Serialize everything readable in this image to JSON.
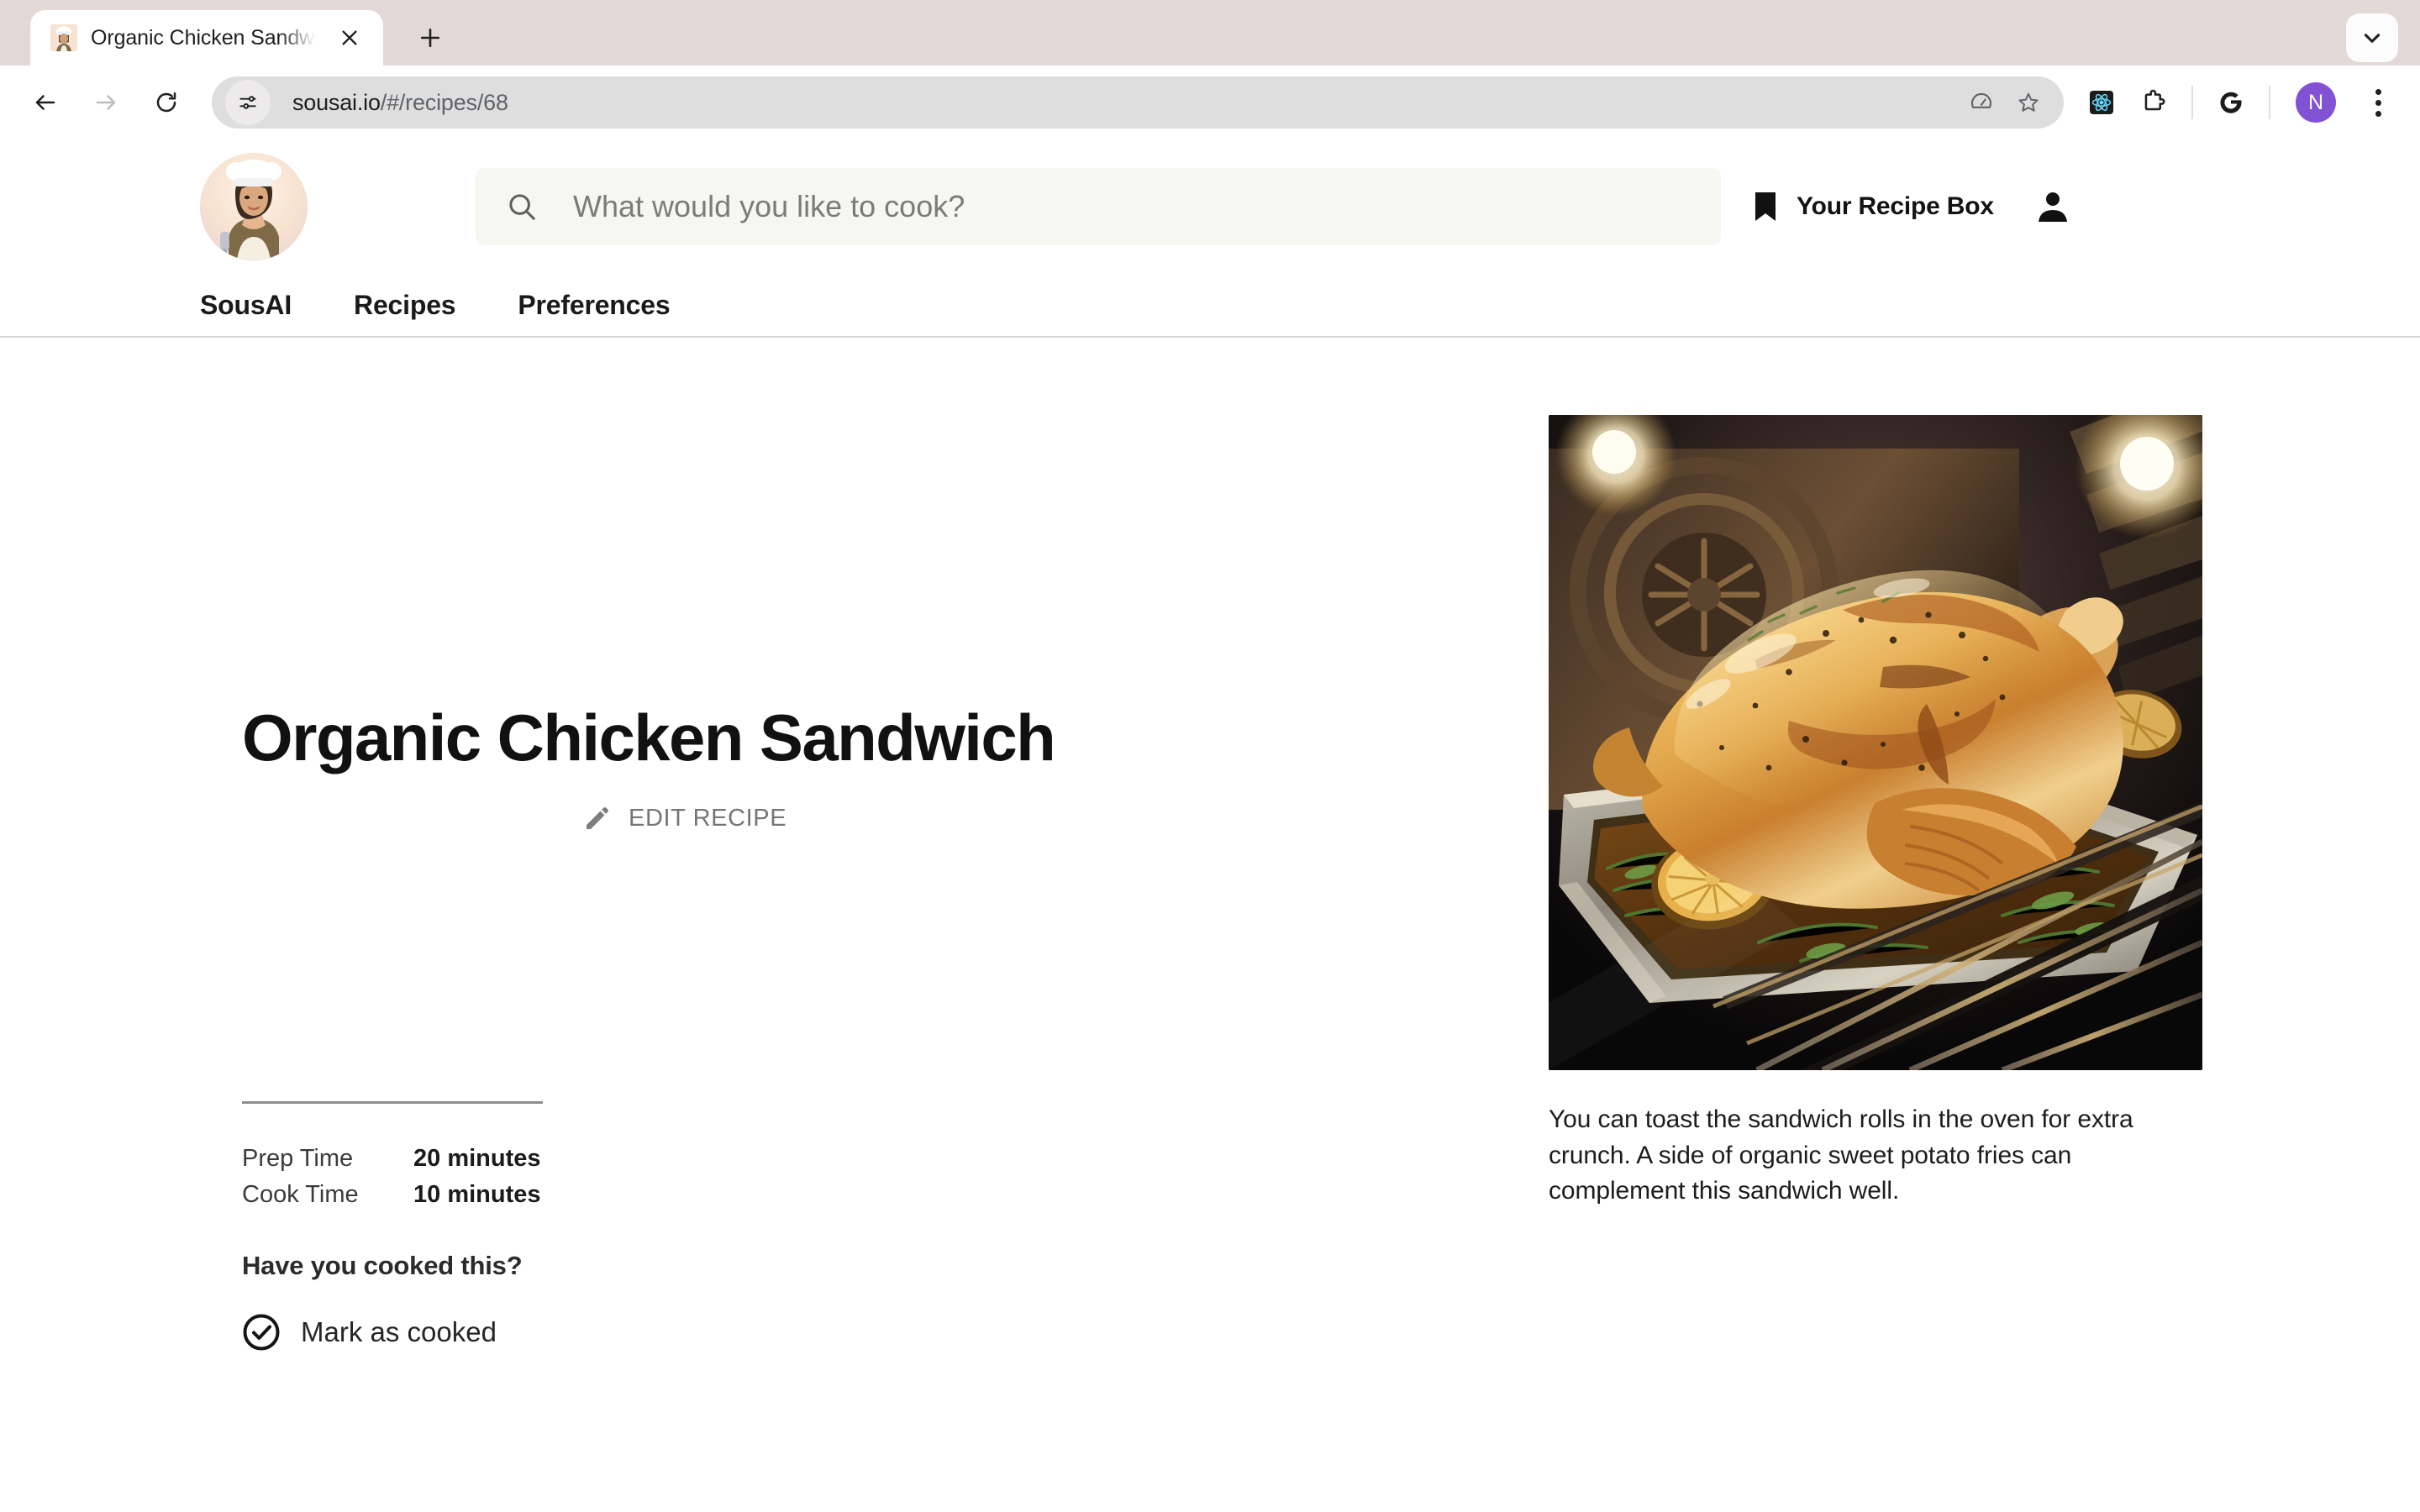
{
  "browser": {
    "tab": {
      "title": "Organic Chicken Sandwich Re",
      "favicon_name": "chef-avatar-favicon"
    },
    "new_tab_label": "+",
    "omnibox": {
      "url_bold": "sousai.io",
      "url_rest": "/#/recipes/68",
      "full_url": "sousai.io/#/recipes/68"
    },
    "profile_initial": "N",
    "extensions": [
      "react-devtools-icon",
      "puzzle-extensions-icon",
      "google-icon"
    ]
  },
  "app": {
    "brand_avatar_name": "chef-avatar-logo",
    "search": {
      "placeholder": "What would you like to cook?",
      "value": ""
    },
    "recipe_box_label": "Your Recipe Box",
    "nav": [
      {
        "label": "SousAI"
      },
      {
        "label": "Recipes"
      },
      {
        "label": "Preferences"
      }
    ]
  },
  "recipe": {
    "title": "Organic Chicken Sandwich",
    "edit_label": "EDIT RECIPE",
    "times": [
      {
        "label": "Prep Time",
        "value": "20 minutes"
      },
      {
        "label": "Cook Time",
        "value": "10 minutes"
      }
    ],
    "cooked_heading": "Have you cooked this?",
    "mark_as_cooked_label": "Mark as cooked",
    "hero_image_alt": "Roasted whole chicken in a baking tray inside an oven with rosemary, thyme and lemon slices",
    "caption": "You can toast the sandwich rolls in the oven for extra crunch. A side of organic sweet potato fries can complement this sandwich well."
  },
  "colors": {
    "chrome_bg": "#e2d9d6",
    "omnibox_bg": "#dedede",
    "search_bg": "#f6f7f1",
    "profile_purple": "#8252d4",
    "muted_text": "#757575",
    "divider": "#d6d6d6"
  }
}
